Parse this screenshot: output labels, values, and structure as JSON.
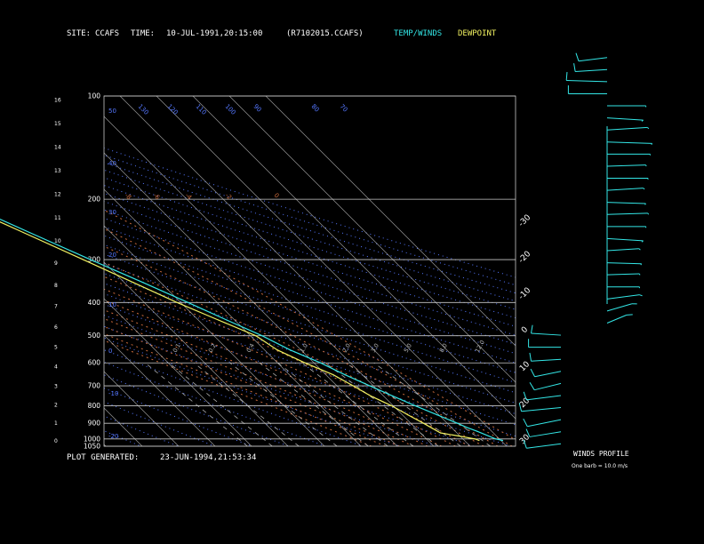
{
  "header": {
    "site_label": "SITE:",
    "site_value": "CCAFS",
    "time_label": "TIME:",
    "time_value": "10-JUL-1991,20:15:00",
    "file_id": "(R7102015.CCAFS)",
    "temp_winds_legend": "TEMP/WINDS",
    "dewpoint_legend": "DEWPOINT"
  },
  "footer": {
    "plot_generated_label": "PLOT GENERATED:",
    "plot_generated_value": "23-JUN-1994,21:53:34"
  },
  "colors": {
    "background": "#000000",
    "temperature": "#33e6e6",
    "dewpoint": "#f0f060",
    "isotherms": "#c8c8c8",
    "isobars": "#c8c8c8",
    "dry_adiabats": "#5577ff",
    "moist_adiabats": "#c86a3c",
    "mixing_ratio": "#aaaaaa"
  },
  "chart_data": [
    {
      "type": "line",
      "subtype": "skew-t log-p",
      "title": "",
      "y_pressure_ticks": [
        "100",
        "200",
        "300",
        "400",
        "500",
        "600",
        "700",
        "800",
        "900",
        "1000",
        "1050"
      ],
      "y_pressure_values": [
        100,
        200,
        300,
        400,
        500,
        600,
        700,
        800,
        900,
        1000,
        1050
      ],
      "y_height_ticks": [
        "16",
        "15",
        "14",
        "13",
        "12",
        "11",
        "10",
        "9",
        "8",
        "7",
        "6",
        "5",
        "4",
        "3",
        "2",
        "1",
        "0"
      ],
      "y_height_values_km": [
        16,
        15,
        14,
        13,
        12,
        11,
        10,
        9,
        8,
        7,
        6,
        5,
        4,
        3,
        2,
        1,
        0
      ],
      "top_temp_ticks": [
        "-110",
        "-100",
        "-90",
        "-80",
        "-70",
        "-60",
        "-50",
        "-40"
      ],
      "top_temp_values": [
        -110,
        -100,
        -90,
        -80,
        -70,
        -60,
        -50,
        -40
      ],
      "right_temp_ticks": [
        "-30",
        "-20",
        "-10",
        "0",
        "10",
        "20",
        "30"
      ],
      "right_temp_values": [
        -30,
        -20,
        -10,
        0,
        10,
        20,
        30
      ],
      "dry_adiabat_labels": [
        "50",
        "40",
        "30",
        "20",
        "10",
        "0",
        "-10",
        "-20",
        "-30"
      ],
      "moist_adiabat_labels": [
        "-8",
        "-6",
        "-4",
        "-2",
        "0"
      ],
      "mixing_ratio_labels": [
        "0.1",
        "0.2",
        "0.4",
        "1.0",
        "2.0",
        "3.0",
        "5.0",
        "8.0",
        "12.0",
        "20.0"
      ],
      "theta_labels_top": [
        "130",
        "120",
        "110",
        "100",
        "90",
        "80",
        "70"
      ],
      "ylim_pressure": [
        1050,
        100
      ],
      "log_pressure_axis": true,
      "series": [
        {
          "name": "TEMP/WINDS",
          "color": "#33e6e6",
          "pressure": [
            1010,
            1000,
            950,
            925,
            900,
            850,
            800,
            750,
            700,
            650,
            600,
            550,
            500,
            450,
            400,
            350,
            300,
            250,
            200,
            175,
            150,
            135,
            125,
            115,
            108,
            100
          ],
          "temperature": [
            30.5,
            29,
            26,
            24.2,
            22.8,
            19.5,
            16,
            12.5,
            9,
            5.2,
            1.8,
            -3,
            -6.8,
            -12.2,
            -18,
            -24.8,
            -33,
            -42.3,
            -53.5,
            -61,
            -68.5,
            -71,
            -69,
            -65,
            -63,
            -60
          ]
        },
        {
          "name": "DEWPOINT",
          "color": "#f0f060",
          "pressure": [
            1010,
            1000,
            980,
            960,
            930,
            900,
            850,
            800,
            750,
            700,
            650,
            600,
            550,
            500,
            450,
            400,
            350,
            300,
            250,
            200
          ],
          "temperature": [
            24,
            23.3,
            19.5,
            15.5,
            14.5,
            13.5,
            11.5,
            9.5,
            6.5,
            4.5,
            2,
            -2.5,
            -6.5,
            -8.5,
            -14.5,
            -21,
            -27.5,
            -35,
            -44,
            -55
          ]
        }
      ],
      "winds": {
        "title": "WINDS PROFILE",
        "legend": "One barb = 10.0 m/s",
        "heights_km": [
          0.1,
          0.6,
          1.1,
          1.6,
          2.1,
          2.6,
          3.1,
          3.6,
          4.1,
          4.6,
          5.1,
          5.6,
          6.1,
          6.6,
          7.1,
          7.6,
          8.1,
          8.6,
          9.1,
          9.6,
          10.1,
          10.6,
          11.1,
          11.6,
          12.1,
          12.6,
          13.1,
          13.6,
          14.1,
          14.6,
          15.1,
          15.6,
          16.1
        ],
        "speed_ms": [
          8,
          7,
          9,
          10,
          8,
          6,
          5,
          5,
          6,
          5,
          5,
          6,
          7,
          6,
          6,
          7,
          6,
          8,
          9,
          10,
          9,
          8,
          10,
          9,
          11,
          12,
          10,
          8,
          9,
          9,
          10,
          6,
          5
        ],
        "direction_deg": [
          250,
          245,
          240,
          255,
          250,
          235,
          240,
          260,
          270,
          280,
          40,
          50,
          70,
          90,
          85,
          95,
          80,
          100,
          90,
          85,
          95,
          80,
          90,
          85,
          90,
          95,
          80,
          100,
          90,
          270,
          275,
          260,
          250
        ]
      }
    }
  ],
  "winds_panel": {
    "title": "WINDS PROFILE",
    "legend": "One barb = 10.0 m/s"
  }
}
